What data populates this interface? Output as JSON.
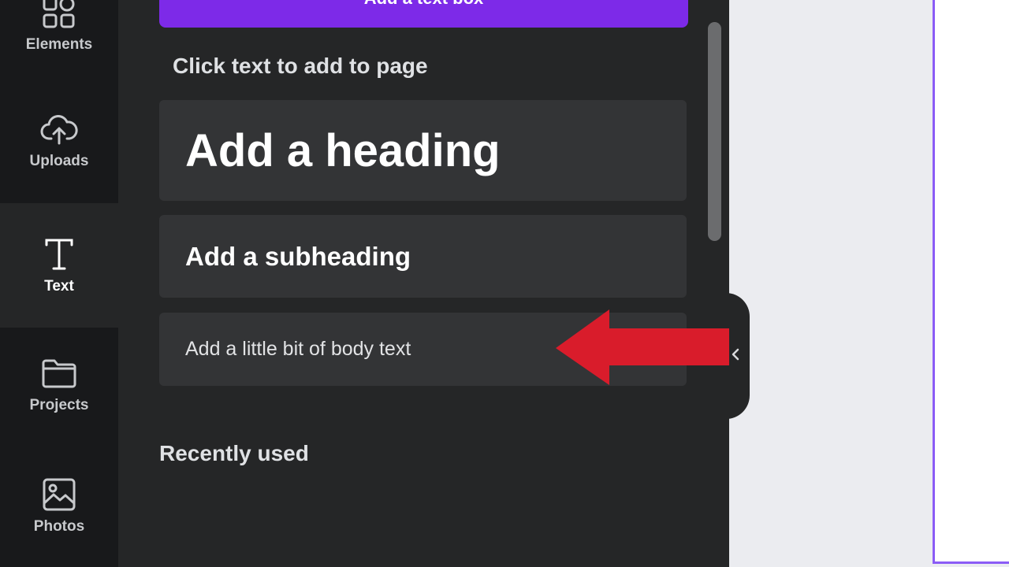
{
  "rail": {
    "items": [
      {
        "label": "Elements",
        "icon": "elements-icon",
        "active": false
      },
      {
        "label": "Uploads",
        "icon": "cloud-upload-icon",
        "active": false
      },
      {
        "label": "Text",
        "icon": "text-icon",
        "active": true
      },
      {
        "label": "Projects",
        "icon": "folder-icon",
        "active": false
      },
      {
        "label": "Photos",
        "icon": "photo-icon",
        "active": false
      }
    ]
  },
  "panel": {
    "add_textbox_label": "Add a text box",
    "click_title": "Click text to add to page",
    "presets": {
      "heading": "Add a heading",
      "subheading": "Add a subheading",
      "body": "Add a little bit of body text"
    },
    "recent_title": "Recently used"
  },
  "colors": {
    "accent": "#7d2ae8",
    "annotation_arrow": "#d91c2b",
    "page_border": "#8b5cf6"
  }
}
